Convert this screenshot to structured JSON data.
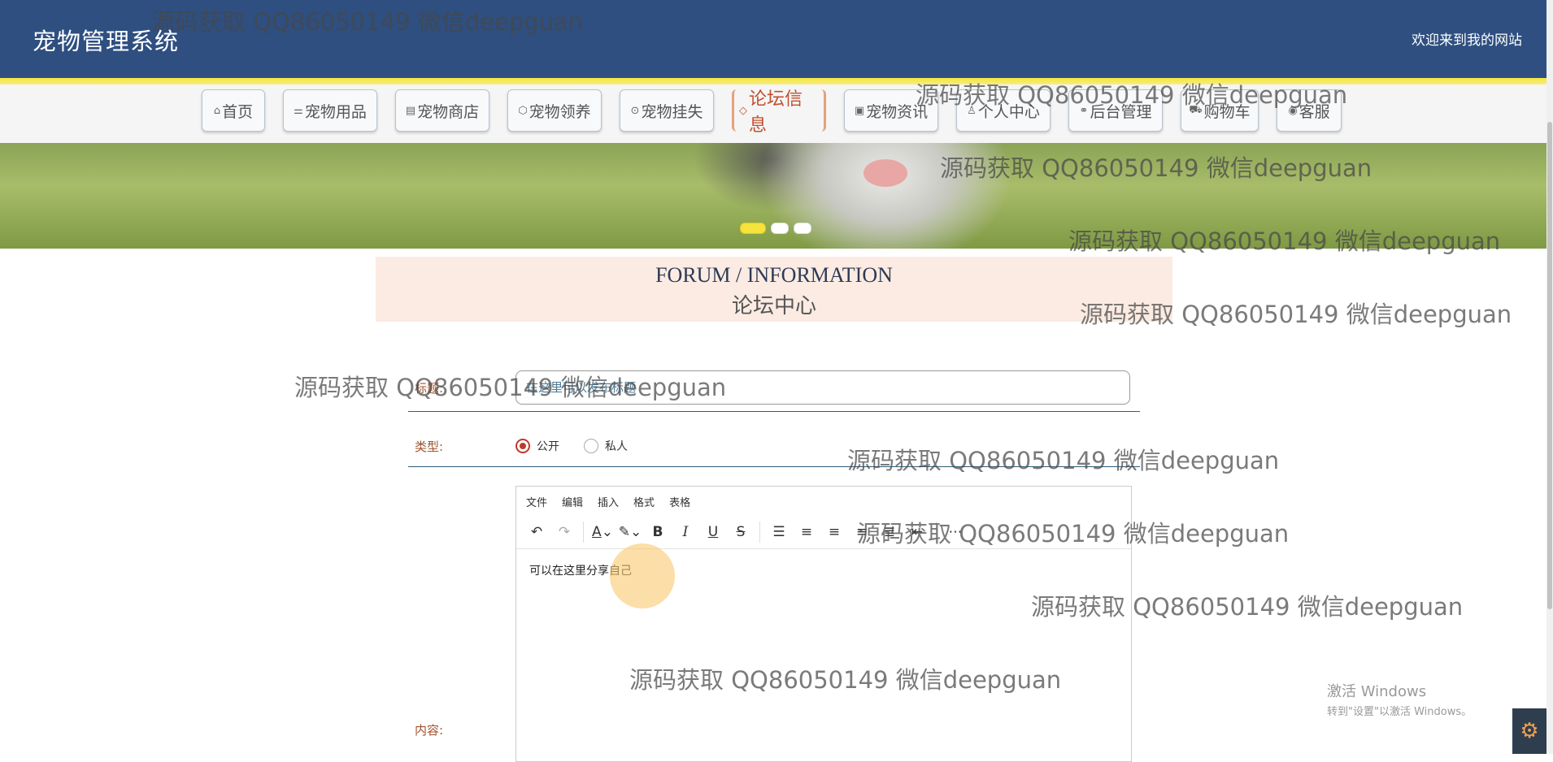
{
  "header": {
    "app_title": "宠物管理系统",
    "welcome": "欢迎来到我的网站"
  },
  "nav": {
    "items": [
      {
        "label": "首页",
        "icon": "home-icon",
        "glyph": "⌂"
      },
      {
        "label": "宠物用品",
        "icon": "sliders-icon",
        "glyph": "⚌"
      },
      {
        "label": "宠物商店",
        "icon": "store-icon",
        "glyph": "▤"
      },
      {
        "label": "宠物领养",
        "icon": "box-icon",
        "glyph": "⬡"
      },
      {
        "label": "宠物挂失",
        "icon": "alert-icon",
        "glyph": "⊙"
      },
      {
        "label": "论坛信息",
        "icon": "tag-icon",
        "glyph": "◇",
        "active": true
      },
      {
        "label": "宠物资讯",
        "icon": "news-icon",
        "glyph": "▣"
      },
      {
        "label": "个人中心",
        "icon": "user-icon",
        "glyph": "♙"
      },
      {
        "label": "后台管理",
        "icon": "link-icon",
        "glyph": "⚭"
      },
      {
        "label": "购物车",
        "icon": "cart-icon",
        "glyph": "⛟"
      },
      {
        "label": "客服",
        "icon": "service-icon",
        "glyph": "◉"
      }
    ]
  },
  "forum": {
    "title_en": "FORUM / INFORMATION",
    "title_cn": "论坛中心"
  },
  "form": {
    "title_label": "标题:",
    "title_placeholder": "在这里可以发布标题",
    "type_label": "类型:",
    "type_options": [
      "公开",
      "私人"
    ],
    "type_selected": "公开",
    "content_label": "内容:"
  },
  "editor": {
    "menus": [
      "文件",
      "编辑",
      "插入",
      "格式",
      "表格"
    ],
    "toolbar_icons": [
      "undo-icon",
      "redo-icon",
      "font-color-icon",
      "highlight-icon",
      "bold-icon",
      "italic-icon",
      "underline-icon",
      "strikethrough-icon",
      "list-icon",
      "align-left-icon",
      "align-center-icon",
      "align-right-icon",
      "justify-icon",
      "outdent-icon",
      "more-icon"
    ],
    "content": "可以在这里分享自己"
  },
  "watermark_text": "源码获取 QQ86050149 微信deepguan",
  "os": {
    "activate_title": "激活 Windows",
    "activate_sub": "转到\"设置\"以激活 Windows。"
  },
  "colors": {
    "header_bg": "#2e4f80",
    "accent": "#c1502e",
    "forum_bg": "#fbebe2"
  }
}
